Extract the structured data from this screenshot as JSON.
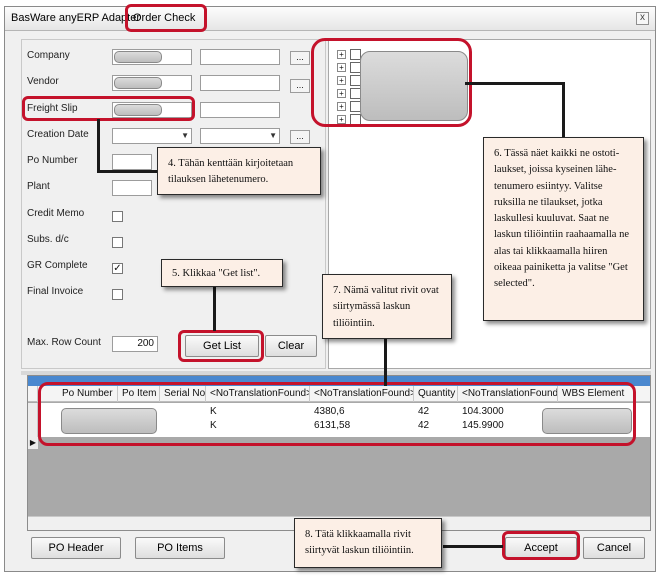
{
  "titlebar": {
    "app_tab": "BasWare anyERP Adapter",
    "active_tab": "Order Check",
    "close_glyph": "x"
  },
  "form": {
    "company_label": "Company",
    "vendor_label": "Vendor",
    "freight_slip_label": "Freight Slip",
    "creation_date_label": "Creation Date",
    "po_number_label": "Po Number",
    "plant_label": "Plant",
    "credit_memo_label": "Credit Memo",
    "subs_label": "Subs. d/c",
    "gr_complete_label": "GR Complete",
    "final_invoice_label": "Final Invoice",
    "max_row_label": "Max. Row Count",
    "max_row_value": "200",
    "dots": "...",
    "gr_complete_checked": "✓",
    "get_list_button": "Get List",
    "clear_button": "Clear"
  },
  "grid": {
    "columns": [
      "Po Number",
      "Po Item",
      "Serial No",
      "<NoTranslationFound>",
      "<NoTranslationFound>",
      "Quantity",
      "<NoTranslationFound>",
      "WBS Element"
    ],
    "rows": [
      {
        "col4": "K",
        "col5": "4380,6",
        "qty": "42",
        "col7": "104.3000"
      },
      {
        "col4": "K",
        "col5": "6131,58",
        "qty": "42",
        "col7": "145.9900"
      }
    ],
    "row_pointer": "▶"
  },
  "bottom": {
    "po_header_button": "PO Header",
    "po_items_button": "PO Items",
    "accept_button": "Accept",
    "cancel_button": "Cancel"
  },
  "notes": {
    "note4": "4. Tähän kenttään kirjoitetaan tilauksen lähetenumero.",
    "note5": "5. Klikkaa \"Get list\".",
    "note6": "6. Tässä näet kaikki ne ostoti-laukset, joissa kyseinen lähe-tenumero esiintyy. Valitse ruksilla ne tilaukset, jotka laskullesi kuuluvat. Saat ne laskun tiliöintiin raahaamalla ne alas tai klikkaamalla hiiren oikeaa painiketta ja valitse \"Get selected\".",
    "note7": "7. Nämä valitut rivit ovat siirtymässä laskun tiliöintiin.",
    "note8": "8. Tätä klikkaamalla rivit siirtyvät laskun tiliöintiin."
  },
  "colors": {
    "highlight": "#c4122b",
    "note_bg": "#fcefe6",
    "grid_header_band": "#4a88cf"
  },
  "icons": [
    "close-icon",
    "dropdown-arrow-icon",
    "tree-expand-icon",
    "checkbox-icon",
    "row-pointer-icon"
  ]
}
